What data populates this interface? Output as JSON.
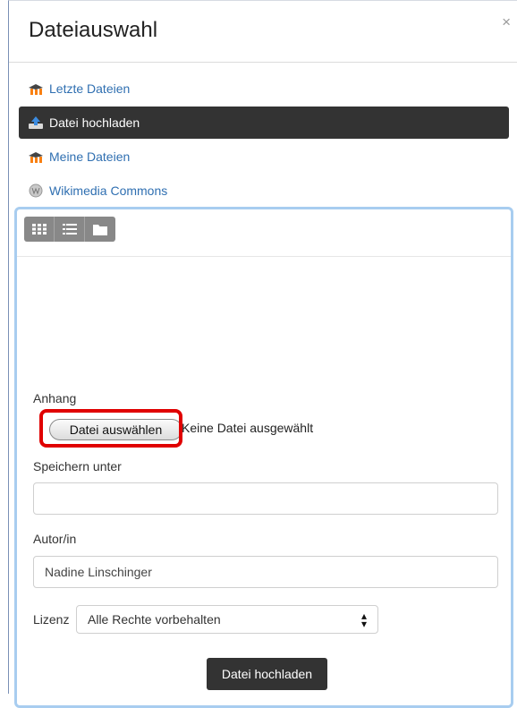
{
  "dialog": {
    "title": "Dateiauswahl",
    "close": "×"
  },
  "repositories": [
    {
      "label": "Letzte Dateien",
      "icon": "moodle-icon"
    },
    {
      "label": "Datei hochladen",
      "icon": "upload-icon",
      "active": true
    },
    {
      "label": "Meine Dateien",
      "icon": "moodle-icon"
    },
    {
      "label": "Wikimedia Commons",
      "icon": "wikimedia-icon"
    }
  ],
  "view_buttons": [
    "grid-view-icon",
    "list-view-icon",
    "folder-view-icon"
  ],
  "form": {
    "attachment_label": "Anhang",
    "choose_file_button": "Datei auswählen",
    "no_file_text": "Keine Datei ausgewählt",
    "save_as_label": "Speichern unter",
    "save_as_value": "",
    "author_label": "Autor/in",
    "author_value": "Nadine Linschinger",
    "license_label": "Lizenz",
    "license_value": "Alle Rechte vorbehalten",
    "submit_button": "Datei hochladen"
  },
  "colors": {
    "link": "#2f6fb1",
    "active_bg": "#333333",
    "panel_border": "#a8cdf0",
    "highlight": "#e00000"
  }
}
